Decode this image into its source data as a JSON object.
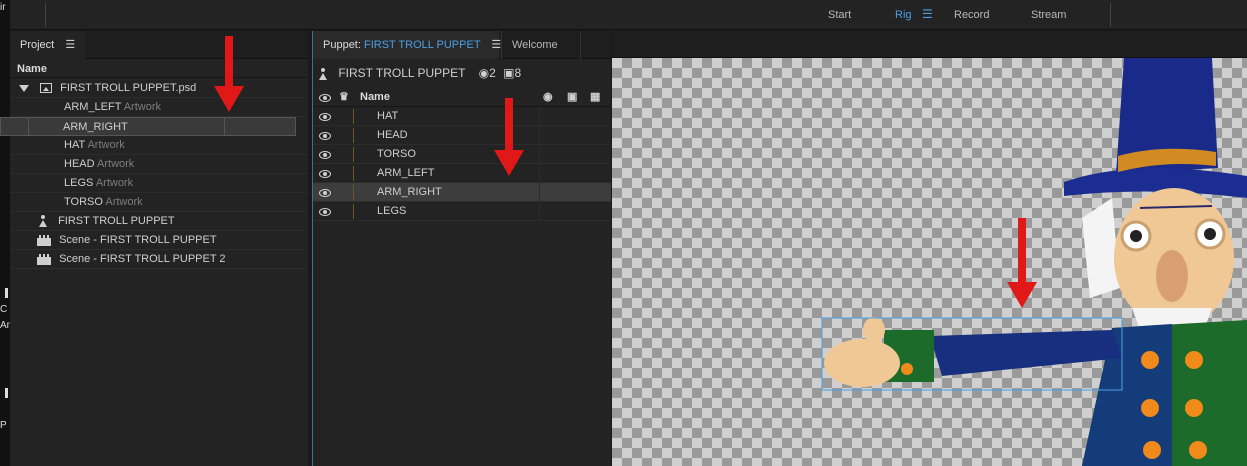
{
  "topbar": {
    "modes": [
      "Start",
      "Rig",
      "Record",
      "Stream"
    ],
    "active_mode": "Rig",
    "menu_glyph": "☰"
  },
  "project": {
    "tab_label": "Project",
    "menu_glyph": "☰",
    "column_name": "Name",
    "psd_file": "FIRST TROLL PUPPET.psd",
    "layers": [
      {
        "name": "ARM_LEFT",
        "type": "Artwork"
      },
      {
        "name": "ARM_RIGHT",
        "type": ""
      },
      {
        "name": "HAT",
        "type": "Artwork"
      },
      {
        "name": "HEAD",
        "type": "Artwork"
      },
      {
        "name": "LEGS",
        "type": "Artwork"
      },
      {
        "name": "TORSO",
        "type": "Artwork"
      }
    ],
    "puppet_item": "FIRST TROLL PUPPET",
    "scenes": [
      "Scene - FIRST TROLL PUPPET",
      "Scene - FIRST TROLL PUPPET 2"
    ]
  },
  "puppet": {
    "tab_prefix": "Puppet:",
    "tab_name": "FIRST TROLL PUPPET",
    "menu_glyph": "☰",
    "welcome_tab": "Welcome",
    "title": "FIRST TROLL PUPPET",
    "handle_count": "2",
    "tag_count": "8",
    "column_name": "Name",
    "layers": [
      "HAT",
      "HEAD",
      "TORSO",
      "ARM_LEFT",
      "ARM_RIGHT",
      "LEGS"
    ],
    "selected_layer": "ARM_RIGHT"
  },
  "colors": {
    "accent": "#4aa0e6",
    "arrow": "#e01818",
    "panel": "#232323",
    "hat": "#1a2a8a",
    "coat": "#1d6b2a",
    "sleeve": "#172f7e",
    "skin": "#f0c896",
    "button": "#f08a1a"
  },
  "desktop_strip_fragments": [
    "ir",
    "C",
    "An",
    "P"
  ]
}
